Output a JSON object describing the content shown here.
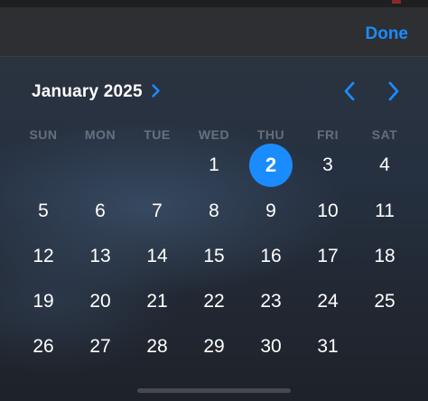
{
  "toolbar": {
    "done_label": "Done"
  },
  "header": {
    "month_label": "January 2025"
  },
  "weekdays": [
    "SUN",
    "MON",
    "TUE",
    "WED",
    "THU",
    "FRI",
    "SAT"
  ],
  "days": [
    "1",
    "2",
    "3",
    "4",
    "5",
    "6",
    "7",
    "8",
    "9",
    "10",
    "11",
    "12",
    "13",
    "14",
    "15",
    "16",
    "17",
    "18",
    "19",
    "20",
    "21",
    "22",
    "23",
    "24",
    "25",
    "26",
    "27",
    "28",
    "29",
    "30",
    "31"
  ],
  "first_weekday_index": 3,
  "selected_day": "2",
  "colors": {
    "accent": "#1a8cff",
    "weekday_text": "#5b5c62",
    "day_text": "#ffffff",
    "nav_bar": "#2e2f32"
  },
  "icons": {
    "month_expand": "chevron-right-icon",
    "previous_month": "chevron-left-icon",
    "next_month": "chevron-right-icon"
  }
}
